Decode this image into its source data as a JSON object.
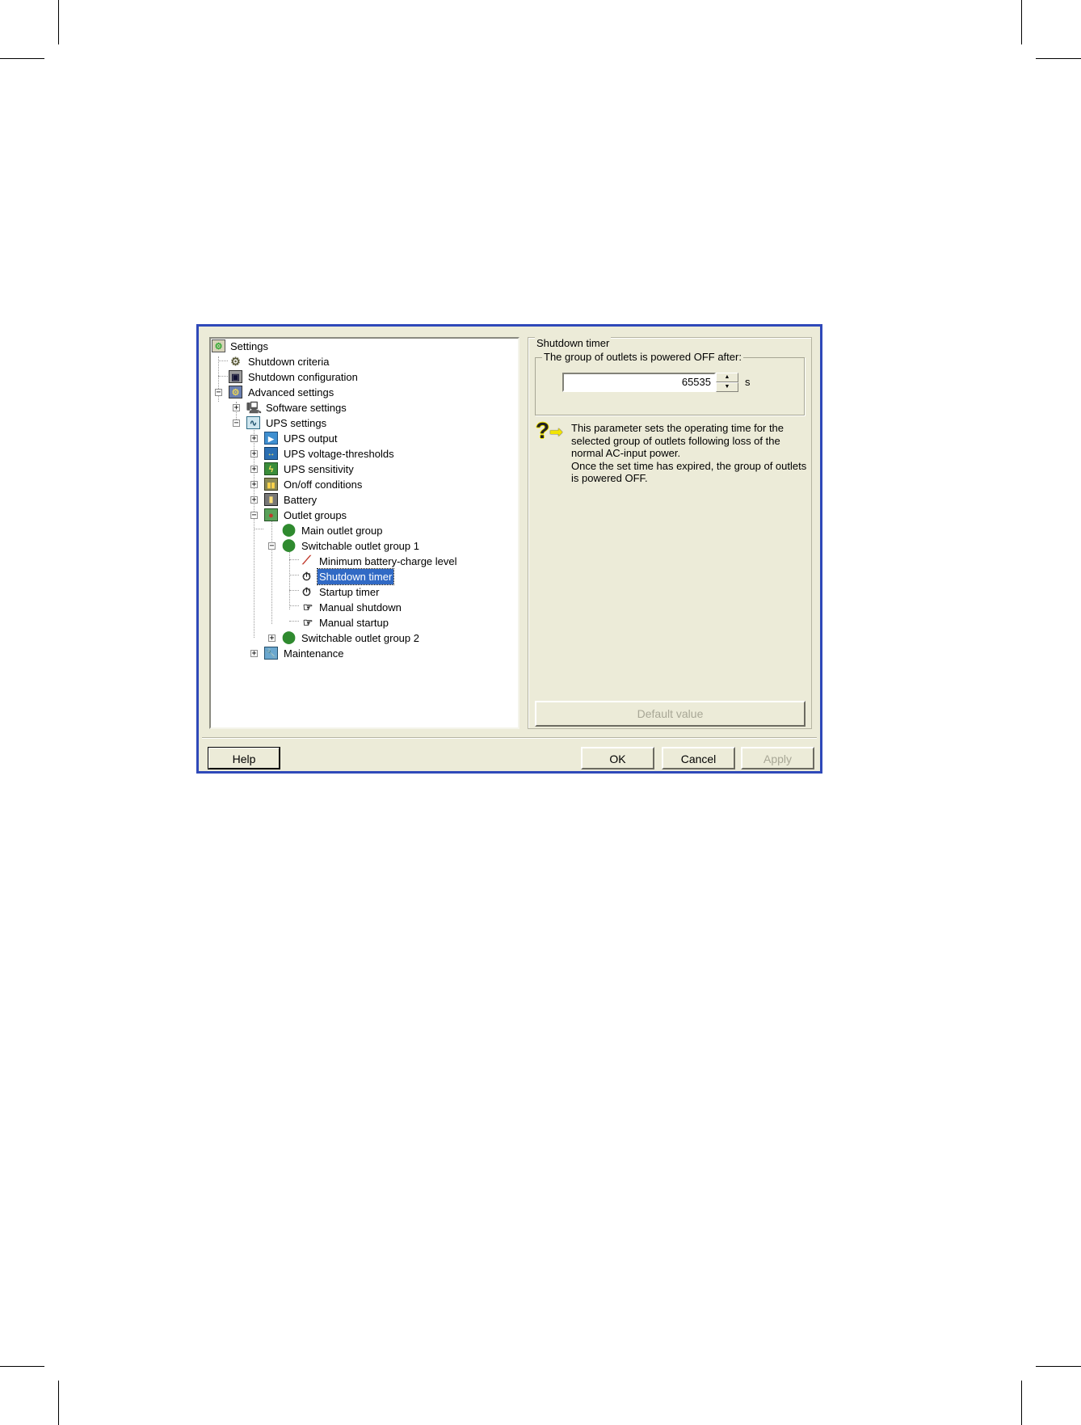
{
  "tree": {
    "items": [
      {
        "label": "Settings",
        "icon": "settings-icon"
      },
      {
        "label": "Shutdown criteria",
        "icon": "gears-icon"
      },
      {
        "label": "Shutdown configuration",
        "icon": "computer-config-icon"
      },
      {
        "label": "Advanced settings",
        "icon": "advanced-settings-icon"
      },
      {
        "label": "Software settings",
        "icon": "computer-icon"
      },
      {
        "label": "UPS settings",
        "icon": "ups-wave-icon"
      },
      {
        "label": "UPS output",
        "icon": "ups-output-icon"
      },
      {
        "label": "UPS voltage-thresholds",
        "icon": "voltage-thresholds-icon"
      },
      {
        "label": "UPS sensitivity",
        "icon": "sensitivity-icon"
      },
      {
        "label": "On/off conditions",
        "icon": "onoff-icon"
      },
      {
        "label": "Battery",
        "icon": "battery-icon"
      },
      {
        "label": "Outlet groups",
        "icon": "outlet-groups-icon"
      },
      {
        "label": "Main outlet group",
        "icon": "outlet-icon"
      },
      {
        "label": "Switchable outlet group 1",
        "icon": "outlet-icon"
      },
      {
        "label": "Minimum battery-charge level",
        "icon": "screwdriver-icon"
      },
      {
        "label": "Shutdown timer",
        "icon": "stopwatch-icon"
      },
      {
        "label": "Startup timer",
        "icon": "stopwatch-icon"
      },
      {
        "label": "Manual shutdown",
        "icon": "hand-pointer-icon"
      },
      {
        "label": "Manual startup",
        "icon": "hand-pointer-icon"
      },
      {
        "label": "Switchable outlet group 2",
        "icon": "outlet-icon"
      },
      {
        "label": "Maintenance",
        "icon": "maintenance-icon"
      }
    ]
  },
  "panel": {
    "group_title": "Shutdown timer",
    "sub_group_title": "The group of outlets is powered OFF after:",
    "value": "65535",
    "unit": "s",
    "help_lines": [
      "This parameter sets the operating time for the",
      "selected group of outlets following loss of the",
      "normal AC-input power.",
      "Once the set time has expired, the group of outlets",
      "is powered OFF."
    ],
    "default_button": "Default value"
  },
  "footer": {
    "help": "Help",
    "ok": "OK",
    "cancel": "Cancel",
    "apply": "Apply"
  },
  "colors": {
    "window_border": "#2f49b9",
    "dialog_bg": "#ecebd8",
    "selection": "#316ac5"
  }
}
